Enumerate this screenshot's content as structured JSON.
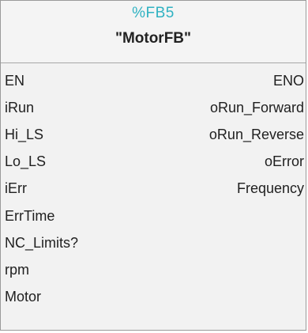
{
  "block": {
    "instance": "%FB5",
    "name": "\"MotorFB\""
  },
  "inputs": [
    "EN",
    "iRun",
    "Hi_LS",
    "Lo_LS",
    "iErr",
    "ErrTime",
    "NC_Limits?",
    "rpm",
    "Motor"
  ],
  "outputs": [
    "ENO",
    "oRun_Forward",
    "oRun_Reverse",
    "oError",
    "Frequency"
  ],
  "colors": {
    "instance_text": "#2fb2c2",
    "block_background": "#f2f2f2",
    "border": "#9a9a9a"
  }
}
